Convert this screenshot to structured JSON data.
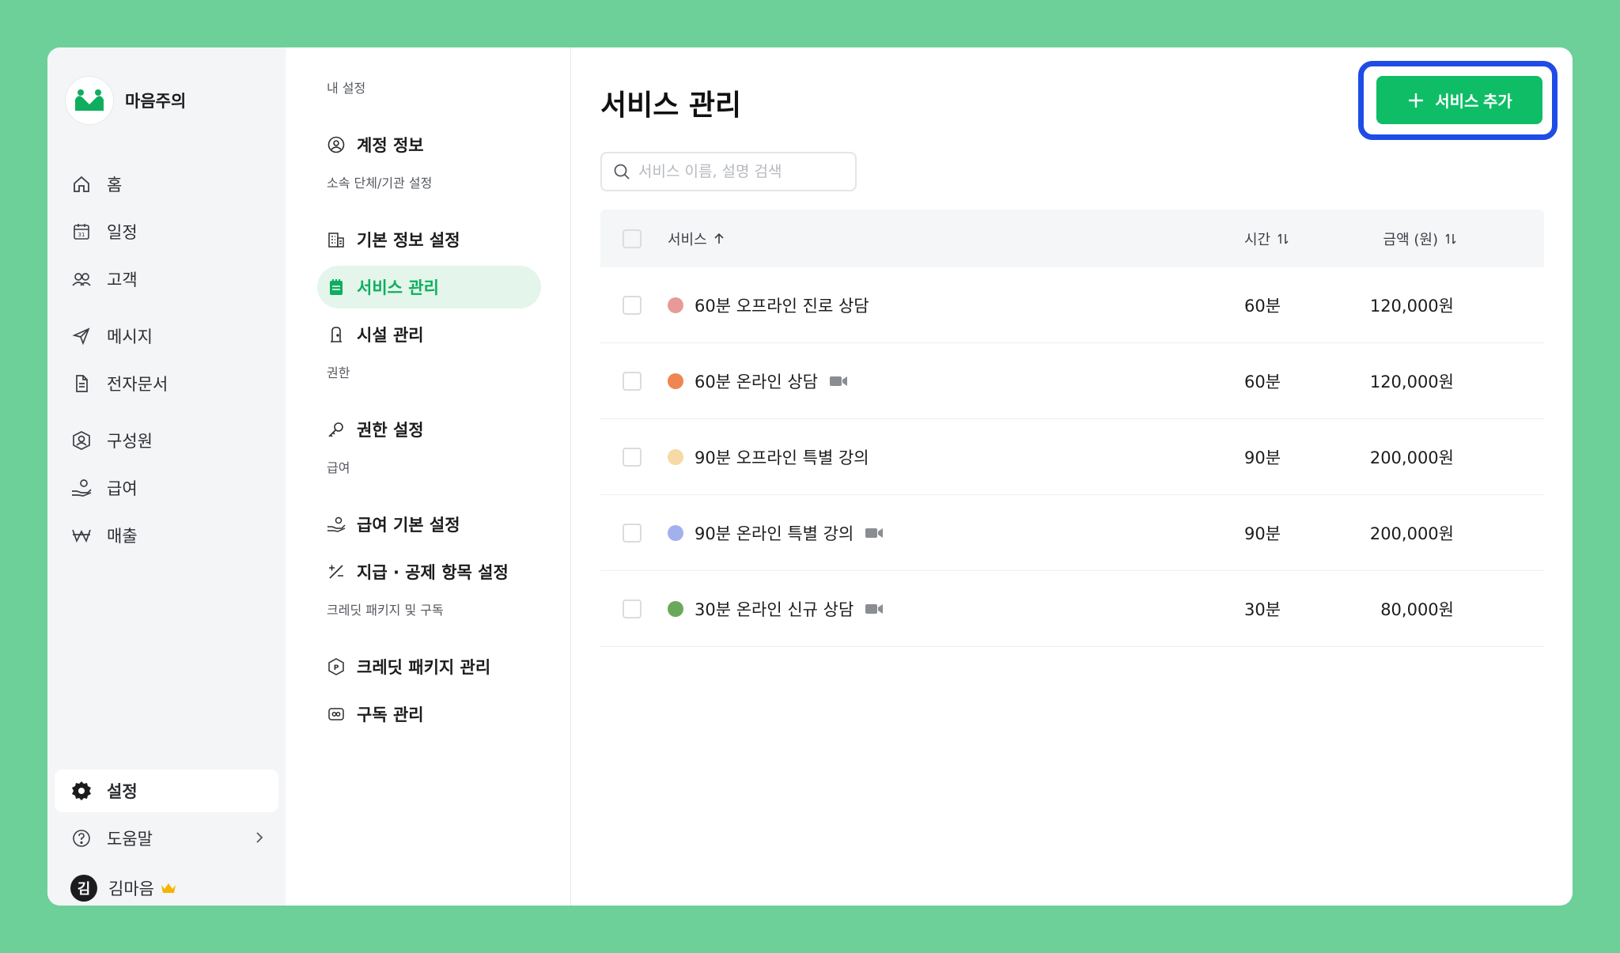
{
  "brand": {
    "name": "마음주의"
  },
  "nav": {
    "items": [
      {
        "label": "홈",
        "icon": "home-icon"
      },
      {
        "label": "일정",
        "icon": "calendar-icon"
      },
      {
        "label": "고객",
        "icon": "users-icon"
      },
      {
        "label": "메시지",
        "icon": "send-icon"
      },
      {
        "label": "전자문서",
        "icon": "document-icon"
      },
      {
        "label": "구성원",
        "icon": "member-icon"
      },
      {
        "label": "급여",
        "icon": "salary-icon"
      },
      {
        "label": "매출",
        "icon": "won-icon"
      }
    ],
    "settings_label": "설정",
    "help_label": "도움말",
    "user": {
      "initial": "김",
      "name": "김마음"
    },
    "calendar_day": "31"
  },
  "subnav": {
    "sections": [
      {
        "heading": "내 설정",
        "items": [
          "계정 정보"
        ]
      },
      {
        "heading": "소속 단체/기관 설정",
        "items": [
          "기본 정보 설정",
          "서비스 관리",
          "시설 관리"
        ]
      },
      {
        "heading": "권한",
        "items": [
          "권한 설정"
        ]
      },
      {
        "heading": "급여",
        "items": [
          "급여 기본 설정",
          "지급 · 공제 항목 설정"
        ]
      },
      {
        "heading": "크레딧 패키지 및 구독",
        "items": [
          "크레딧 패키지 관리",
          "구독 관리"
        ]
      }
    ],
    "active_item": "서비스 관리"
  },
  "main": {
    "title": "서비스 관리",
    "add_button_label": "서비스 추가",
    "search_placeholder": "서비스 이름, 설명 검색",
    "columns": {
      "service": "서비스",
      "time": "시간",
      "price": "금액 (원)"
    },
    "rows": [
      {
        "name": "60분 오프라인 진로 상담",
        "color": "#e79a98",
        "video": false,
        "time": "60분",
        "price": "120,000원"
      },
      {
        "name": "60분 온라인 상담",
        "color": "#ef8651",
        "video": true,
        "time": "60분",
        "price": "120,000원"
      },
      {
        "name": "90분 오프라인 특별 강의",
        "color": "#f6d9a4",
        "video": false,
        "time": "90분",
        "price": "200,000원"
      },
      {
        "name": "90분 온라인 특별 강의",
        "color": "#a3b0ee",
        "video": true,
        "time": "90분",
        "price": "200,000원"
      },
      {
        "name": "30분 온라인 신규 상담",
        "color": "#6aa959",
        "video": true,
        "time": "30분",
        "price": "80,000원"
      }
    ]
  },
  "colors": {
    "accent": "#0fbd67",
    "focus_ring": "#1f4ce6",
    "active_bg": "#e4f6eb",
    "background": "#6dd098"
  }
}
